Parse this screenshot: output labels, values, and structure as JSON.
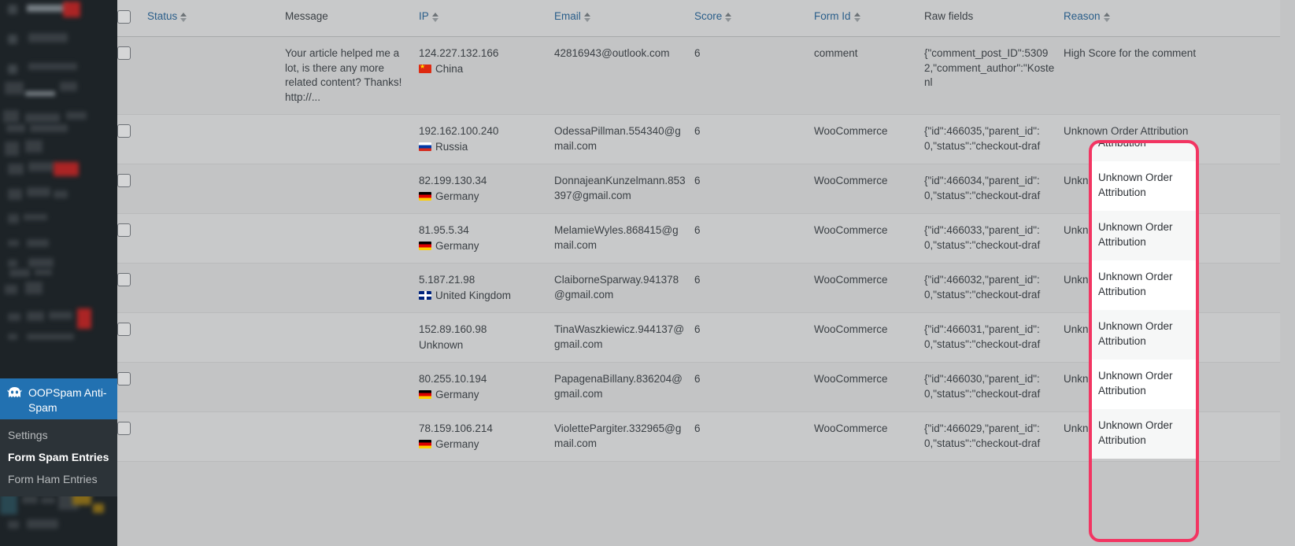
{
  "sidebar": {
    "current_menu": {
      "label": "OOPSpam Anti-Spam",
      "icon": "ghost-icon"
    },
    "submenu": [
      {
        "label": "Settings",
        "current": false
      },
      {
        "label": "Form Spam Entries",
        "current": true
      },
      {
        "label": "Form Ham Entries",
        "current": false
      }
    ]
  },
  "table": {
    "columns": [
      {
        "key": "checkbox",
        "label": "",
        "sortable": false
      },
      {
        "key": "status",
        "label": "Status",
        "sortable": true
      },
      {
        "key": "message",
        "label": "Message",
        "sortable": false
      },
      {
        "key": "ip",
        "label": "IP",
        "sortable": true
      },
      {
        "key": "email",
        "label": "Email",
        "sortable": true
      },
      {
        "key": "score",
        "label": "Score",
        "sortable": true
      },
      {
        "key": "form_id",
        "label": "Form Id",
        "sortable": true
      },
      {
        "key": "raw_fields",
        "label": "Raw fields",
        "sortable": false
      },
      {
        "key": "reason",
        "label": "Reason",
        "sortable": true
      }
    ],
    "rows": [
      {
        "status": "",
        "message": "Your article helped me a lot, is there any more related content? Thanks! http://...",
        "ip": "124.227.132.166",
        "country": "China",
        "country_code": "cn",
        "email": "42816943@outlook.com",
        "score": "6",
        "form_id": "comment",
        "raw_fields": "{\"comment_post_ID\":53092,\"comment_author\":\"Kostenl",
        "reason": "High Score for the comment"
      },
      {
        "status": "",
        "message": "",
        "ip": "192.162.100.240",
        "country": "Russia",
        "country_code": "ru",
        "email": "OdessaPillman.554340@gmail.com",
        "score": "6",
        "form_id": "WooCommerce",
        "raw_fields": "{\"id\":466035,\"parent_id\":0,\"status\":\"checkout-draf",
        "reason": "Unknown Order Attribution"
      },
      {
        "status": "",
        "message": "",
        "ip": "82.199.130.34",
        "country": "Germany",
        "country_code": "de",
        "email": "DonnajeanKunzelmann.853397@gmail.com",
        "score": "6",
        "form_id": "WooCommerce",
        "raw_fields": "{\"id\":466034,\"parent_id\":0,\"status\":\"checkout-draf",
        "reason": "Unknown Order Attribution"
      },
      {
        "status": "",
        "message": "",
        "ip": "81.95.5.34",
        "country": "Germany",
        "country_code": "de",
        "email": "MelamieWyles.868415@gmail.com",
        "score": "6",
        "form_id": "WooCommerce",
        "raw_fields": "{\"id\":466033,\"parent_id\":0,\"status\":\"checkout-draf",
        "reason": "Unknown Order Attribution"
      },
      {
        "status": "",
        "message": "",
        "ip": "5.187.21.98",
        "country": "United Kingdom",
        "country_code": "gb",
        "email": "ClaiborneSparway.941378@gmail.com",
        "score": "6",
        "form_id": "WooCommerce",
        "raw_fields": "{\"id\":466032,\"parent_id\":0,\"status\":\"checkout-draf",
        "reason": "Unknown Order Attribution"
      },
      {
        "status": "",
        "message": "",
        "ip": "152.89.160.98",
        "country": "Unknown",
        "country_code": "",
        "email": "TinaWaszkiewicz.944137@gmail.com",
        "score": "6",
        "form_id": "WooCommerce",
        "raw_fields": "{\"id\":466031,\"parent_id\":0,\"status\":\"checkout-draf",
        "reason": "Unknown Order Attribution"
      },
      {
        "status": "",
        "message": "",
        "ip": "80.255.10.194",
        "country": "Germany",
        "country_code": "de",
        "email": "PapagenaBillany.836204@gmail.com",
        "score": "6",
        "form_id": "WooCommerce",
        "raw_fields": "{\"id\":466030,\"parent_id\":0,\"status\":\"checkout-draf",
        "reason": "Unknown Order Attribution"
      },
      {
        "status": "",
        "message": "",
        "ip": "78.159.106.214",
        "country": "Germany",
        "country_code": "de",
        "email": "ViolettePargiter.332965@gmail.com",
        "score": "6",
        "form_id": "WooCommerce",
        "raw_fields": "{\"id\":466029,\"parent_id\":0,\"status\":\"checkout-draf",
        "reason": "Unknown Order Attribution"
      }
    ]
  },
  "annotation": {
    "highlight_color": "#f23562",
    "highlight_target_column": "Reason"
  }
}
